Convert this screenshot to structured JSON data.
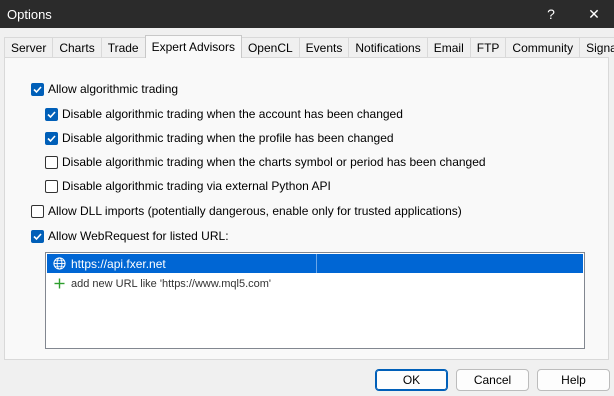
{
  "window": {
    "title": "Options",
    "help_glyph": "?",
    "close_glyph": "✕"
  },
  "tabs": [
    {
      "label": "Server"
    },
    {
      "label": "Charts"
    },
    {
      "label": "Trade"
    },
    {
      "label": "Expert Advisors",
      "active": true
    },
    {
      "label": "OpenCL"
    },
    {
      "label": "Events"
    },
    {
      "label": "Notifications"
    },
    {
      "label": "Email"
    },
    {
      "label": "FTP"
    },
    {
      "label": "Community"
    },
    {
      "label": "Signals"
    }
  ],
  "options": {
    "allow_algo": {
      "label": "Allow algorithmic trading",
      "checked": true
    },
    "disable_account": {
      "label": "Disable algorithmic trading when the account has been changed",
      "checked": true
    },
    "disable_profile": {
      "label": "Disable algorithmic trading when the profile has been changed",
      "checked": true
    },
    "disable_symbol": {
      "label": "Disable algorithmic trading when the charts symbol or period has been changed",
      "checked": false
    },
    "disable_python": {
      "label": "Disable algorithmic trading via external Python API",
      "checked": false
    },
    "allow_dll": {
      "label": "Allow DLL imports (potentially dangerous, enable only for trusted applications)",
      "checked": false
    },
    "allow_webrequest": {
      "label": "Allow WebRequest for listed URL:",
      "checked": true
    }
  },
  "url_list": {
    "items": [
      {
        "text": "https://api.fxer.net",
        "icon": "globe-icon",
        "selected": true
      }
    ],
    "add_hint": "add new URL like 'https://www.mql5.com'",
    "add_icon": "plus-icon"
  },
  "buttons": {
    "ok": "OK",
    "cancel": "Cancel",
    "help": "Help"
  },
  "colors": {
    "accent": "#005fb8",
    "selection": "#0066d4",
    "titlebar": "#2b2b2b",
    "add_plus": "#2e9e2e"
  }
}
